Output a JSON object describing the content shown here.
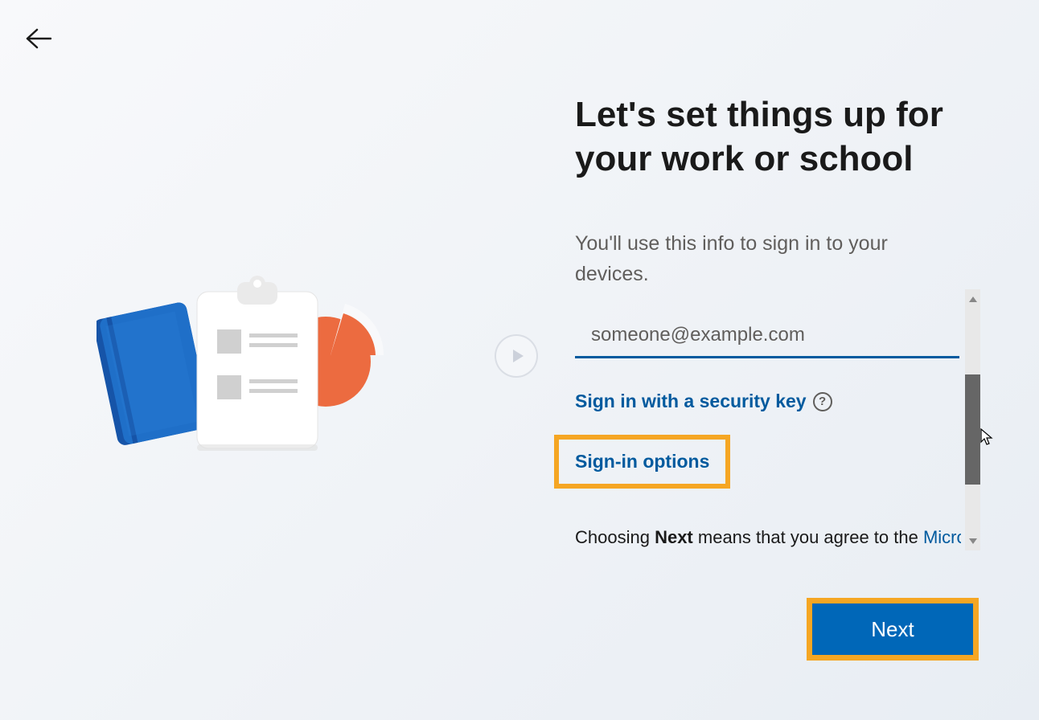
{
  "heading": "Let's set things up for your work or school",
  "subtitle": "You'll use this info to sign in to your devices.",
  "email": {
    "placeholder": "someone@example.com",
    "value": ""
  },
  "links": {
    "security_key": "Sign in with a security key",
    "signin_options": "Sign-in options"
  },
  "agreement": {
    "prefix": "Choosing ",
    "bold": "Next",
    "middle": " means that you agree to the ",
    "link": "Micro"
  },
  "buttons": {
    "next": "Next"
  },
  "icons": {
    "back": "back-arrow-icon",
    "help": "?",
    "play": "play-icon"
  },
  "colors": {
    "primary_blue": "#0067b8",
    "link_blue": "#005a9e",
    "highlight_orange": "#f5a623",
    "notebook_blue": "#1f6fc8",
    "pie_orange": "#ec6b40"
  }
}
